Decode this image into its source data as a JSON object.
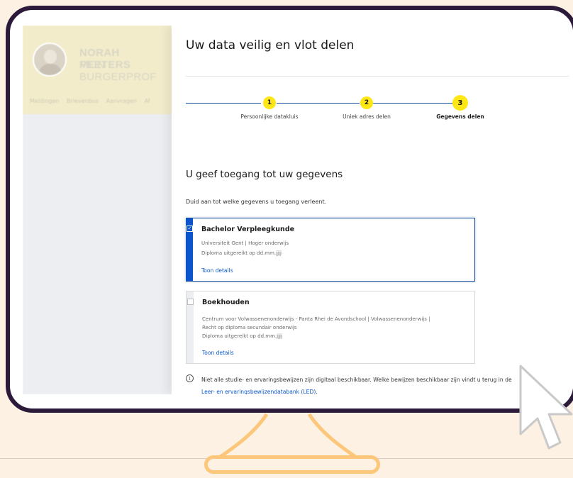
{
  "background_app": {
    "profile_name": "NORAH PEETERS",
    "profile_sub": "MIJN BURGERPROF",
    "nav": [
      "Meldingen",
      "Brievenbus",
      "Aanvragen",
      "Af"
    ]
  },
  "panel": {
    "title": "Uw data veilig en vlot delen",
    "steps": [
      {
        "number": "1",
        "label": "Persoonlijke datakluis",
        "active": false
      },
      {
        "number": "2",
        "label": "Uniek adres delen",
        "active": false
      },
      {
        "number": "3",
        "label": "Gegevens delen",
        "active": true
      }
    ],
    "section_title": "U geef toegang tot uw gegevens",
    "section_sub": "Duid aan tot welke gegevens u toegang verleent.",
    "cards": [
      {
        "checked": true,
        "title": "Bachelor Verpleegkunde",
        "lines": [
          "Universiteit Gent | Hoger onderwijs",
          "Diploma uitgereikt op dd.mm.jjjj"
        ],
        "link": "Toon details"
      },
      {
        "checked": false,
        "title": "Boekhouden",
        "lines": [
          "Centrum voor Volwassenenonderwijs - Panta Rhei de Avondschool | Volwassenenonderwijs |",
          "Recht op diploma secundair onderwijs",
          "Diploma uitgereikt op dd.mm.jjjj"
        ],
        "link": "Toon details"
      }
    ],
    "info": {
      "text_before": "Niet alle studie- en ervaringsbewijzen zijn digitaal beschikbaar. Welke bewijzen beschikbaar zijn vindt u terug in de ",
      "link": "Leer- en ervaringsbewijzendatabank (LED)",
      "text_after": "."
    }
  },
  "colors": {
    "frame": "#2c1a3a",
    "accent_yellow": "#ffe615",
    "link_blue": "#0a55cc",
    "stand_orange": "#fcc77a",
    "backdrop": "#fdf1e3"
  }
}
